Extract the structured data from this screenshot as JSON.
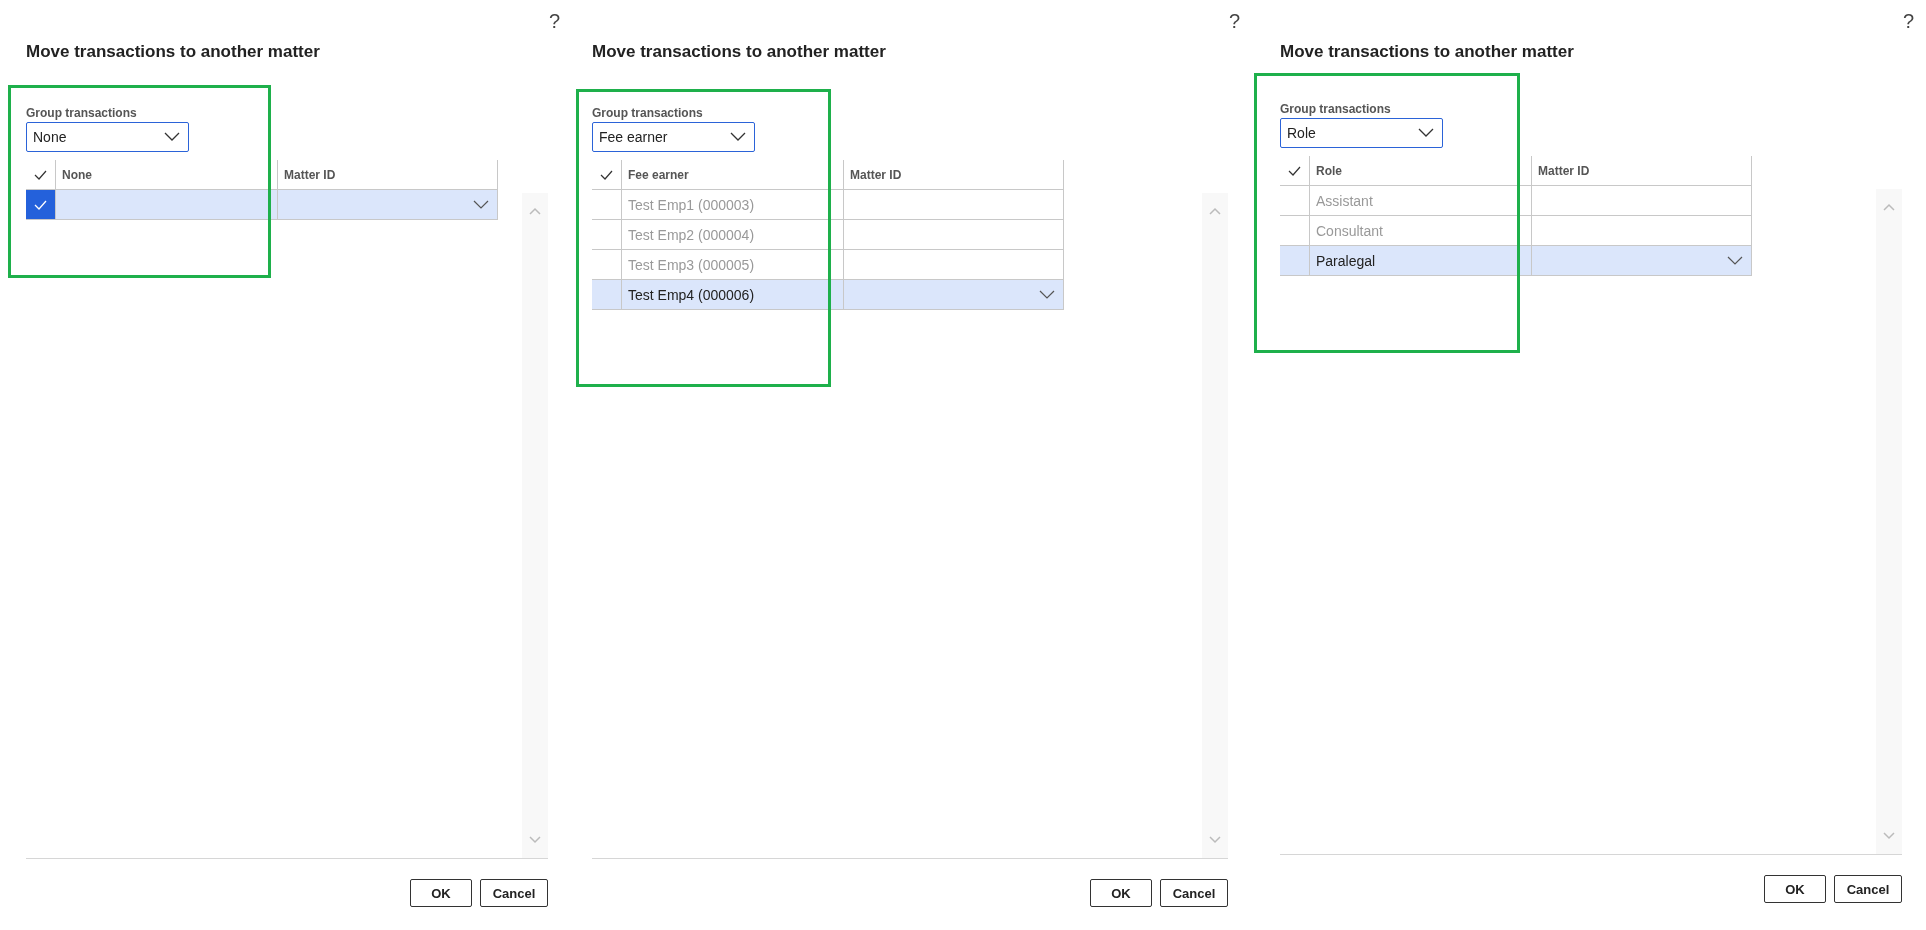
{
  "panels": [
    {
      "help": "?",
      "title": "Move transactions to another matter",
      "group_label": "Group transactions",
      "group_value": "None",
      "columns": [
        "None",
        "Matter ID"
      ],
      "rows": [
        {
          "selected": true,
          "checked": true
        }
      ],
      "buttons": [
        "OK",
        "Cancel"
      ]
    },
    {
      "help": "?",
      "title": "Move transactions to another matter",
      "group_label": "Group transactions",
      "group_value": "Fee earner",
      "columns": [
        "Fee earner",
        "Matter ID"
      ],
      "rows": [
        {
          "name": "Test Emp1 (000003)",
          "selected": false,
          "checked": false
        },
        {
          "name": "Test Emp2 (000004)",
          "selected": false,
          "checked": false
        },
        {
          "name": "Test Emp3 (000005)",
          "selected": false,
          "checked": false
        },
        {
          "name": "Test Emp4 (000006)",
          "selected": true,
          "checked": false
        }
      ],
      "buttons": [
        "OK",
        "Cancel"
      ]
    },
    {
      "help": "?",
      "title": "Move transactions to another matter",
      "group_label": "Group transactions",
      "group_value": "Role",
      "columns": [
        "Role",
        "Matter ID"
      ],
      "rows": [
        {
          "name": "Assistant",
          "selected": false,
          "checked": false
        },
        {
          "name": "Consultant",
          "selected": false,
          "checked": false
        },
        {
          "name": "Paralegal",
          "selected": true,
          "checked": false
        }
      ],
      "buttons": [
        "OK",
        "Cancel"
      ]
    }
  ]
}
